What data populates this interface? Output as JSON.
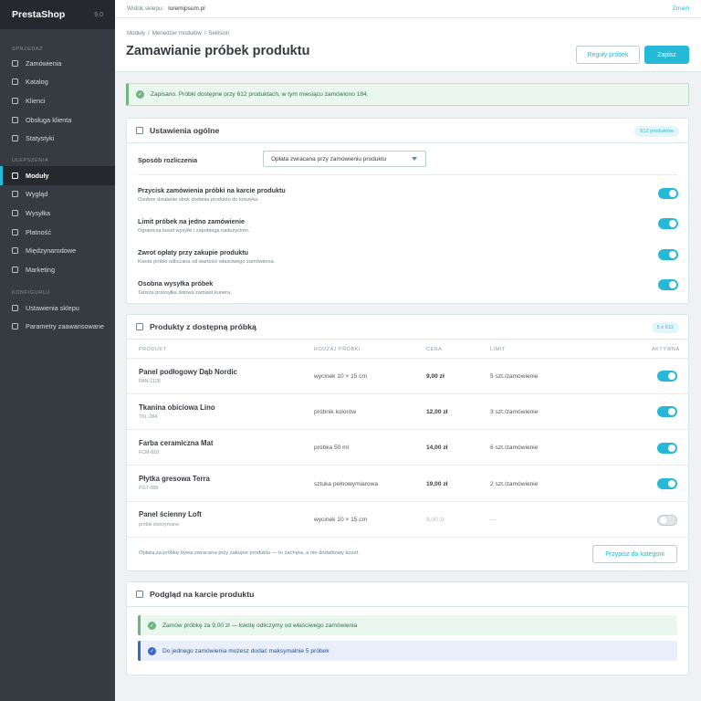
{
  "sidebar": {
    "brand": "PrestaShop",
    "version": "9.0",
    "sections": [
      {
        "label": "SPRZEDAŻ",
        "items": [
          "Zamówienia",
          "Katalog",
          "Klienci",
          "Obsługa klienta",
          "Statystyki"
        ]
      },
      {
        "label": "ULEPSZENIA",
        "items": [
          "Moduły",
          "Wygląd",
          "Wysyłka",
          "Płatność",
          "Międzynarodowe",
          "Marketing"
        ]
      },
      {
        "label": "KONFIGURUJ",
        "items": [
          "Ustawienia sklepu",
          "Parametry zaawansowane"
        ]
      }
    ],
    "active": "Moduły"
  },
  "topbar": {
    "shop_label": "Widok sklepu:",
    "shop_value": "loremipsum.pl",
    "change": "Zmień"
  },
  "header": {
    "breadcrumb": [
      "Moduły",
      "Menedżer modułów",
      "Sellision"
    ],
    "title": "Zamawianie próbek produktu",
    "rules_button": "Reguły próbek",
    "save_button": "Zapisz"
  },
  "alert": {
    "text": "Zapisano. Próbki dostępne przy 612 produktach, w tym miesiącu zamówiono 184."
  },
  "general": {
    "title": "Ustawienia ogólne",
    "badge": "612 produktów",
    "billing_label": "Sposób rozliczenia",
    "billing_value": "Opłata zwracana przy zamówieniu produktu",
    "options": [
      {
        "title": "Przycisk zamówienia próbki na karcie produktu",
        "hint": "Osobne działanie obok dodania produktu do koszyka.",
        "on": true
      },
      {
        "title": "Limit próbek na jedno zamówienie",
        "hint": "Ogranicza koszt wysyłki i zapobiega nadużyciom.",
        "on": true
      },
      {
        "title": "Zwrot opłaty przy zakupie produktu",
        "hint": "Kwota próbki odliczana od wartości właściwego zamówienia.",
        "on": true
      },
      {
        "title": "Osobna wysyłka próbek",
        "hint": "Tańsza przesyłka listowa zamiast kuriera.",
        "on": true
      }
    ]
  },
  "products": {
    "title": "Produkty z dostępną próbką",
    "badge": "5 z 612",
    "columns": [
      "PRODUKT",
      "RODZAJ PRÓBKI",
      "CENA",
      "LIMIT",
      "AKTYWNA"
    ],
    "rows": [
      {
        "name": "Panel podłogowy Dąb Nordic",
        "sku": "PAN-1128",
        "type": "wycinek 10 × 15 cm",
        "price": "9,00 zł",
        "limit": "5 szt./zamówienie",
        "on": true
      },
      {
        "name": "Tkanina obiciowa Lino",
        "sku": "TKL-284",
        "type": "próbnik kolorów",
        "price": "12,00 zł",
        "limit": "3 szt./zamówienie",
        "on": true
      },
      {
        "name": "Farba ceramiczna Mat",
        "sku": "FCM-818",
        "type": "próbka 50 ml",
        "price": "14,00 zł",
        "limit": "6 szt./zamówienie",
        "on": true
      },
      {
        "name": "Płytka gresowa Terra",
        "sku": "PGT-088",
        "type": "sztuka pełnowymiarowa",
        "price": "19,00 zł",
        "limit": "2 szt./zamówienie",
        "on": true
      },
      {
        "name": "Panel ścienny Loft",
        "sku": "próbki wstrzymane",
        "type": "wycinek 10 × 15 cm",
        "price": "9,00 zł",
        "limit": "—",
        "on": false
      }
    ],
    "footer_note": "Opłata za próbkę bywa zwracana przy zakupie produktu — to zachęta, a nie dodatkowy koszt.",
    "assign_button": "Przypisz do kategorii"
  },
  "preview": {
    "title": "Podgląd na karcie produktu",
    "green": "Zamów próbkę za 9,00 zł — kwotę odliczymy od właściwego zamówienia",
    "blue": "Do jednego zamówienia możesz dodać maksymalnie 5 próbek"
  },
  "colors": {
    "accent": "#25b9d7",
    "sidebar": "#363a41",
    "success": "#70b580",
    "info": "#3a67c4"
  }
}
